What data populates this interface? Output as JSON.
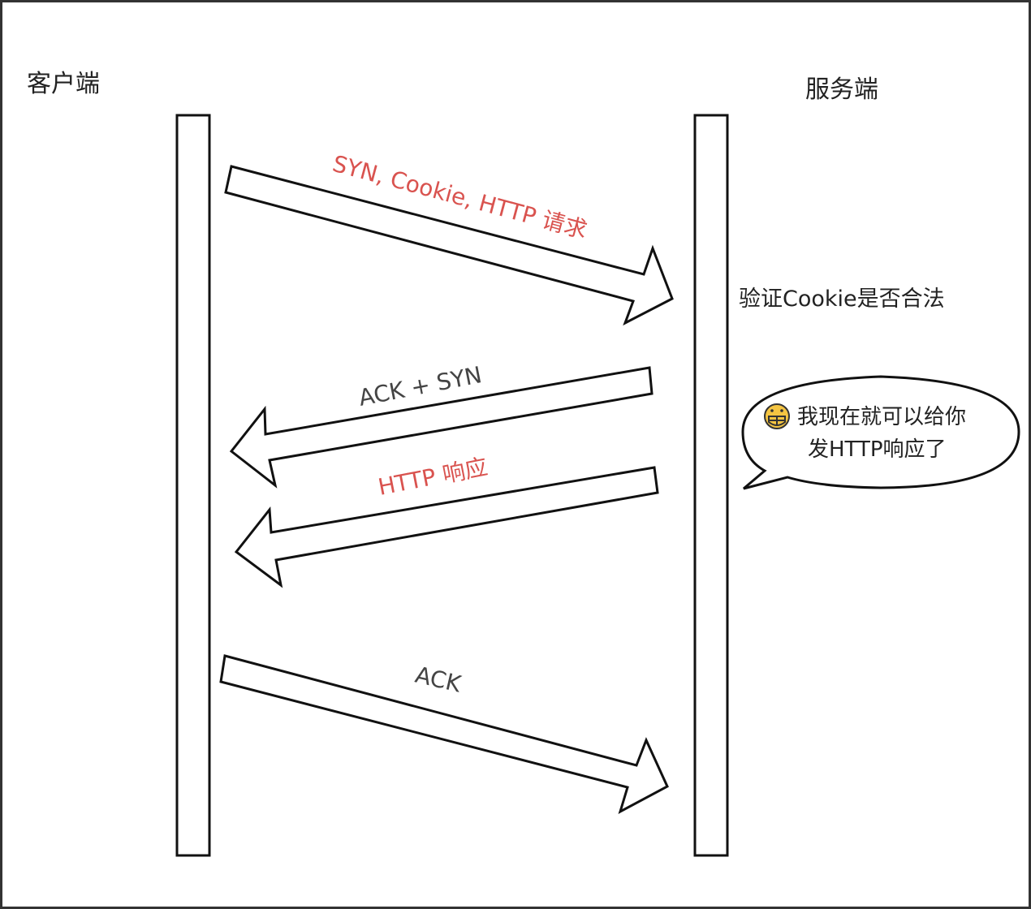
{
  "colors": {
    "highlight": "#d9534f",
    "normal": "#444444"
  },
  "actors": {
    "client": "客户端",
    "server": "服务端"
  },
  "messages": [
    {
      "label": "SYN, Cookie, HTTP 请求",
      "color": "#d9534f"
    },
    {
      "label": "ACK + SYN",
      "color": "#444444"
    },
    {
      "label": "HTTP 响应",
      "color": "#d9534f"
    },
    {
      "label": "ACK",
      "color": "#444444"
    }
  ],
  "server_note": "验证Cookie是否合法",
  "speech_bubble": {
    "icon": "grinning-face-icon",
    "line1": "我现在就可以给你",
    "line2": "发HTTP响应了"
  }
}
